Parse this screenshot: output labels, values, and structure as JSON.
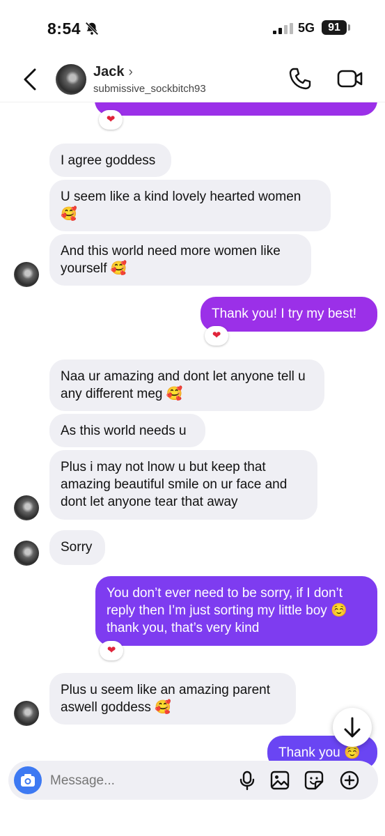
{
  "status_bar": {
    "time": "8:54",
    "network": "5G",
    "battery": "91"
  },
  "header": {
    "name": "Jack",
    "chevron": "›",
    "username": "submissive_sockbitch93"
  },
  "messages": [
    {
      "from": "them",
      "text": "I agree goddess"
    },
    {
      "from": "them",
      "text": "U seem like a kind lovely hearted women 🥰"
    },
    {
      "from": "them",
      "text": "And this world need more women like yourself 🥰"
    },
    {
      "from": "me",
      "text": "Thank you! I try my best!",
      "reaction": "❤"
    },
    {
      "from": "them",
      "text": "Naa ur amazing and dont let anyone tell u any different meg 🥰"
    },
    {
      "from": "them",
      "text": "As this world needs u"
    },
    {
      "from": "them",
      "text": "Plus i may not lnow u but keep that amazing beautiful smile on ur face and dont let anyone tear that away"
    },
    {
      "from": "them",
      "text": "Sorry"
    },
    {
      "from": "me",
      "text": "You don’t ever need to be sorry, if I don’t reply then I’m just sorting my little boy ☺️ thank you, that’s very kind",
      "reaction": "❤"
    },
    {
      "from": "them",
      "text": "Plus u seem like an amazing parent aswell goddess 🥰"
    },
    {
      "from": "me",
      "text": "Thank you ☺️"
    }
  ],
  "top_partial_reaction": "❤",
  "composer": {
    "placeholder": "Message..."
  },
  "colors": {
    "purple_1": "#9b30e8",
    "purple_2": "#7e3cf0",
    "purple_3": "#6a45f3",
    "camera": "#3d79f2"
  },
  "icons": [
    "bell-slash-icon",
    "back-icon",
    "phone-icon",
    "video-icon",
    "arrow-down-icon",
    "camera-icon",
    "mic-icon",
    "image-icon",
    "sticker-icon",
    "plus-icon"
  ]
}
